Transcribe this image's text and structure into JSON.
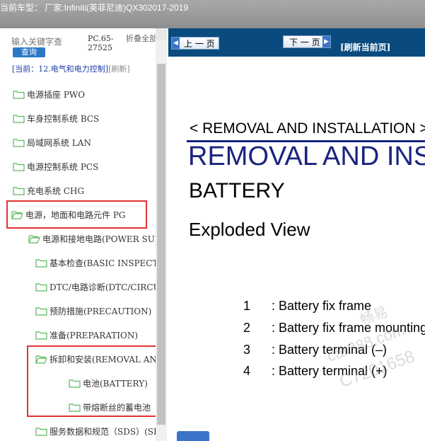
{
  "header": {
    "title": "当前车型： 厂家:Infiniti(英菲尼迪)QX302017-2019"
  },
  "sidebar": {
    "search_placeholder": "输入关键字查",
    "search_button": "查询",
    "pc_code": "PC.65-27525",
    "collapse_all": "折叠全部",
    "current_prefix": "[当前：12.电气和电力控制]",
    "refresh": "[刷新]",
    "items": [
      {
        "label": "电源插座 PWO"
      },
      {
        "label": "车身控制系统 BCS"
      },
      {
        "label": "局域网系统 LAN"
      },
      {
        "label": "电源控制系统 PCS"
      },
      {
        "label": "充电系统 CHG"
      },
      {
        "label": "电源，地面和电路元件 PG"
      },
      {
        "label": "电源和接地电路(POWER SUPPLY"
      },
      {
        "label": "基本检查(BASIC INSPECTION)"
      },
      {
        "label": "DTC/电路诊断(DTC/CIRCUIT"
      },
      {
        "label": "预防措施(PRECAUTION)"
      },
      {
        "label": "准备(PREPARATION)"
      },
      {
        "label": "拆卸和安装(REMOVAL AND"
      },
      {
        "label": "电池(BATTERY)"
      },
      {
        "label": "带熔断丝的蓄电池"
      },
      {
        "label": "服务数据和规范（SDS）(SERVICE"
      }
    ]
  },
  "nav": {
    "prev": "上 一 页",
    "next": "下 一 页",
    "refresh": "[刷新当前页]"
  },
  "doc": {
    "breadcrumb": "< REMOVAL AND INSTALLATION >",
    "heading": "REMOVAL AND INSTALLATION",
    "subheading": "BATTERY",
    "section": "Exploded View",
    "parts": [
      {
        "num": "1",
        "text": ": Battery fix frame"
      },
      {
        "num": "2",
        "text": ": Battery fix frame mounting"
      },
      {
        "num": "3",
        "text": ": Battery terminal (–)"
      },
      {
        "num": "4",
        "text": ": Battery terminal (+)"
      }
    ]
  },
  "watermark": {
    "line1": "畅易",
    "line2": "car388.com",
    "line3": "C7201658"
  },
  "colors": {
    "accent": "#0a4b7f",
    "highlight": "#e53333",
    "heading": "#1a237e",
    "folder": "#5cb85c"
  }
}
